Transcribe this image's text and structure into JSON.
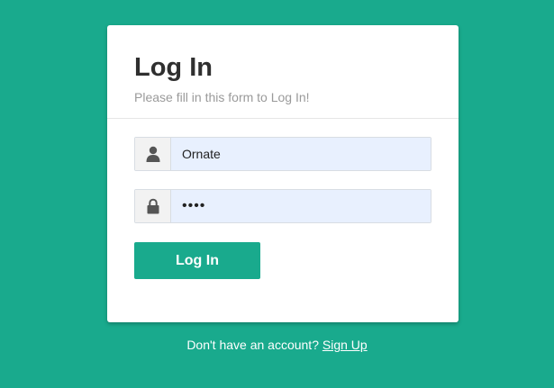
{
  "form": {
    "title": "Log In",
    "subtitle": "Please fill in this form to Log In!",
    "username": {
      "icon": "user-icon",
      "value": "Ornate"
    },
    "password": {
      "icon": "lock-icon",
      "value": "abcd"
    },
    "submit_label": "Log In"
  },
  "footer": {
    "text": "Don't have an account?",
    "link": "Sign Up"
  },
  "colors": {
    "background": "#19aa8d",
    "button": "#19aa8d",
    "input_fill": "#e8f0fe"
  }
}
